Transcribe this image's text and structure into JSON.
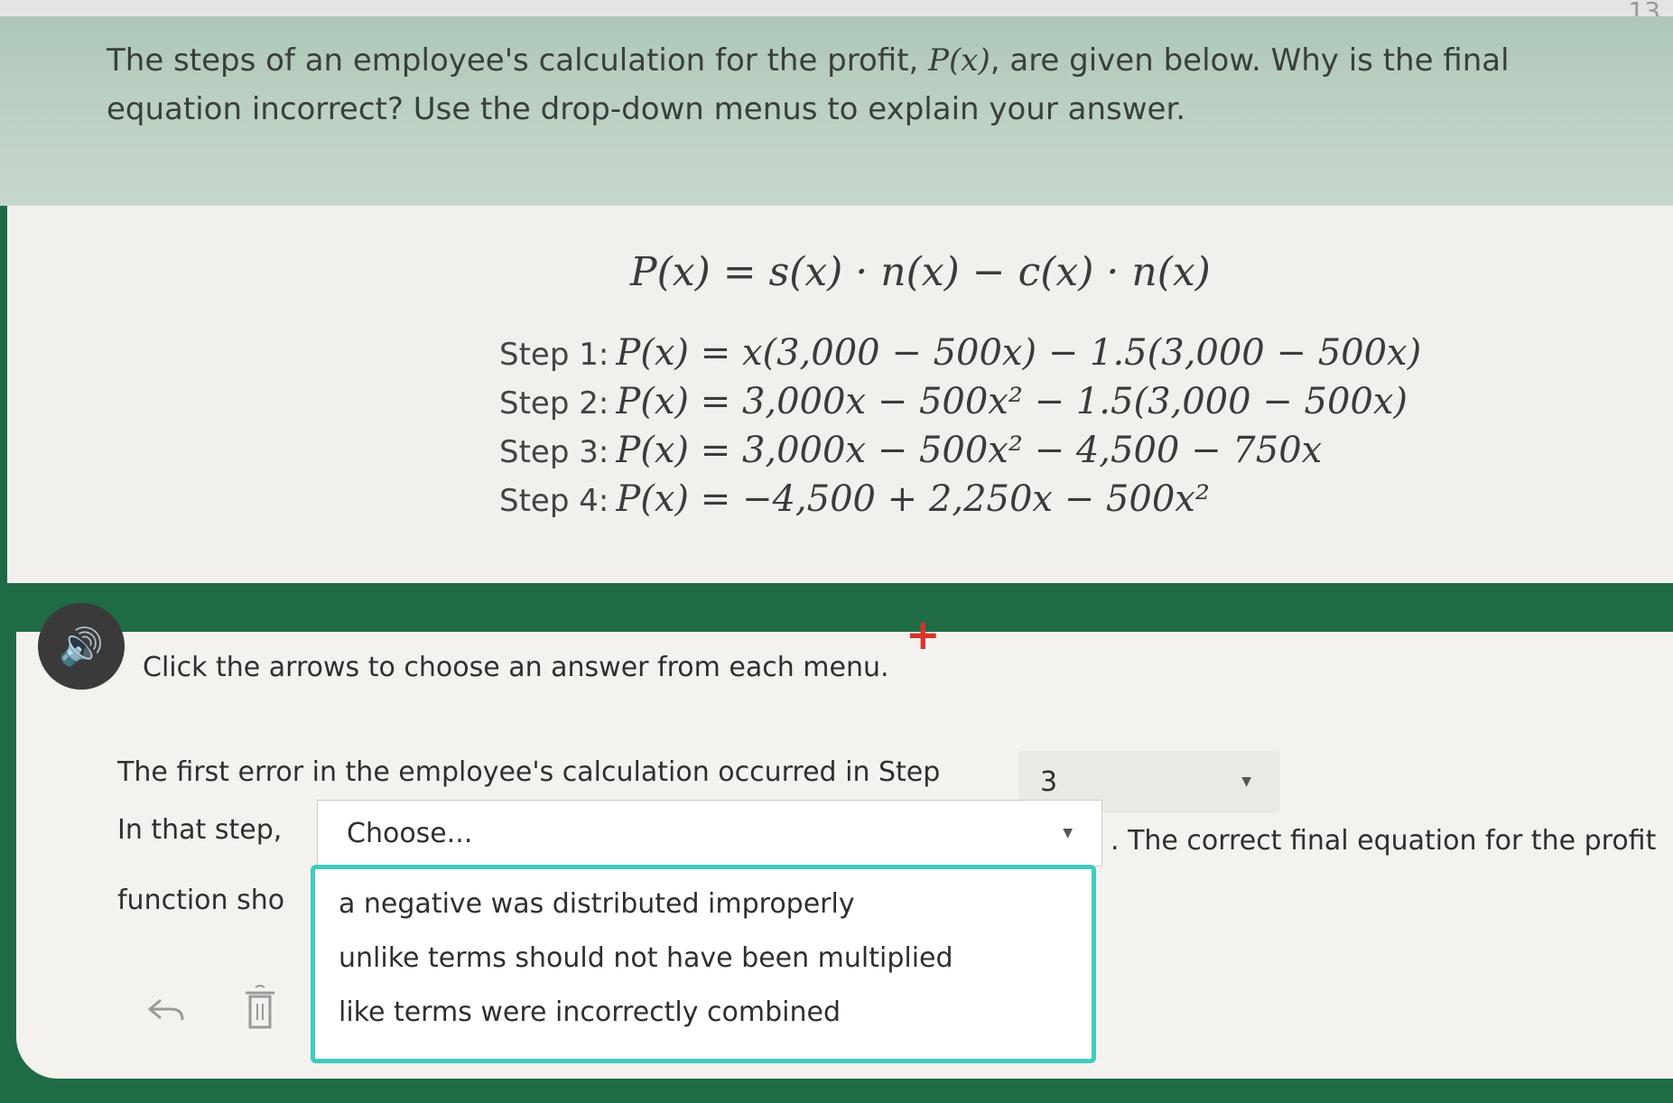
{
  "page_number": "13",
  "prompt": {
    "line1_before": "The steps of an employee's calculation for the profit, ",
    "math": "P(x)",
    "line1_after": ", are given below. Why is the final",
    "line2": "equation incorrect? Use the drop-down menus to explain your answer."
  },
  "equation": "P(x) = s(x) · n(x) − c(x) · n(x)",
  "steps": [
    {
      "label": "Step 1:",
      "eq": "P(x) = x(3,000 − 500x) − 1.5(3,000 − 500x)"
    },
    {
      "label": "Step 2:",
      "eq": "P(x) = 3,000x − 500x² − 1.5(3,000 − 500x)"
    },
    {
      "label": "Step 3:",
      "eq": "P(x) = 3,000x − 500x² − 4,500 − 750x"
    },
    {
      "label": "Step 4:",
      "eq": "P(x) = −4,500 + 2,250x − 500x²"
    }
  ],
  "answer": {
    "instruction": "Click the arrows to choose an answer from each menu.",
    "first_error_text": "The first error in the employee's calculation occurred in Step",
    "step_select_value": "3",
    "in_that_step_text": "In that step,",
    "choose_placeholder": "Choose...",
    "after_choose_text": ". The correct final equation for the profit",
    "function_text": "function sho",
    "dropdown_options": [
      "a negative was distributed improperly",
      "unlike terms should not have been multiplied",
      "like terms were incorrectly combined"
    ]
  },
  "colors": {
    "frame_green": "#1f6b45",
    "highlight_teal": "#3fcbbf",
    "panel_background": "#f4f2ee"
  },
  "icons": [
    "audio-icon",
    "back-arrow-icon",
    "trash-icon",
    "cursor-plus-icon"
  ]
}
